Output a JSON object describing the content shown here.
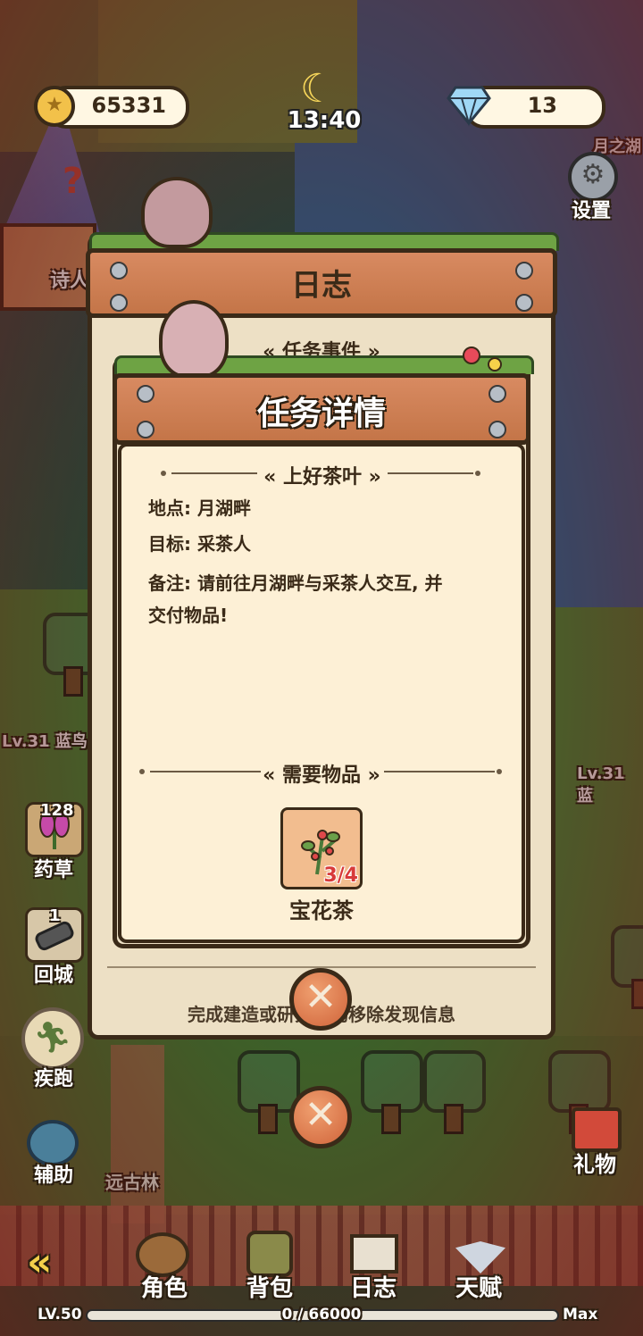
{
  "hud": {
    "coins": "65331",
    "time": "13:40",
    "diamonds": "13",
    "settings_label": "设置",
    "location_hint": "月之湖"
  },
  "world_labels": {
    "npc_poet": "诗人",
    "enemy_level_left": "Lv.31 蓝鸟",
    "enemy_level_right": "Lv.31 蓝",
    "area_name": "远古林"
  },
  "side_items": [
    {
      "label": "药草",
      "count": "128",
      "icon": "herb-icon"
    },
    {
      "label": "回城",
      "count": "1",
      "icon": "return-scroll-icon"
    },
    {
      "label": "疾跑",
      "icon": "sprint-icon"
    },
    {
      "label": "辅助",
      "icon": "assist-icon"
    }
  ],
  "gift_label": "礼物",
  "log_panel": {
    "title": "日志",
    "section": "任务事件",
    "footer_hint": "完成建造或研究自动移除发现信息"
  },
  "detail": {
    "title": "任务详情",
    "quest_name": "上好茶叶",
    "location_label": "地点:",
    "location_value": "月湖畔",
    "target_label": "目标:",
    "target_value": "采茶人",
    "note_label": "备注:",
    "note_value_line1": "请前往月湖畔与采茶人交互, 并",
    "note_value_line2": "交付物品!",
    "required_title": "需要物品",
    "item_name": "宝花茶",
    "item_progress": "3/4"
  },
  "bottom_nav": {
    "back_symbol": "«",
    "tabs": [
      "角色",
      "背包",
      "日志",
      "天赋"
    ]
  },
  "xp": {
    "level": "LV.50",
    "progress_text": "0 / 66000",
    "max_label": "Max",
    "fraction": 0
  },
  "colors": {
    "panel_bg": "#ede0c5",
    "plank": "#d88a61",
    "outline": "#3a2a18",
    "item_count": "#d83a3a"
  }
}
